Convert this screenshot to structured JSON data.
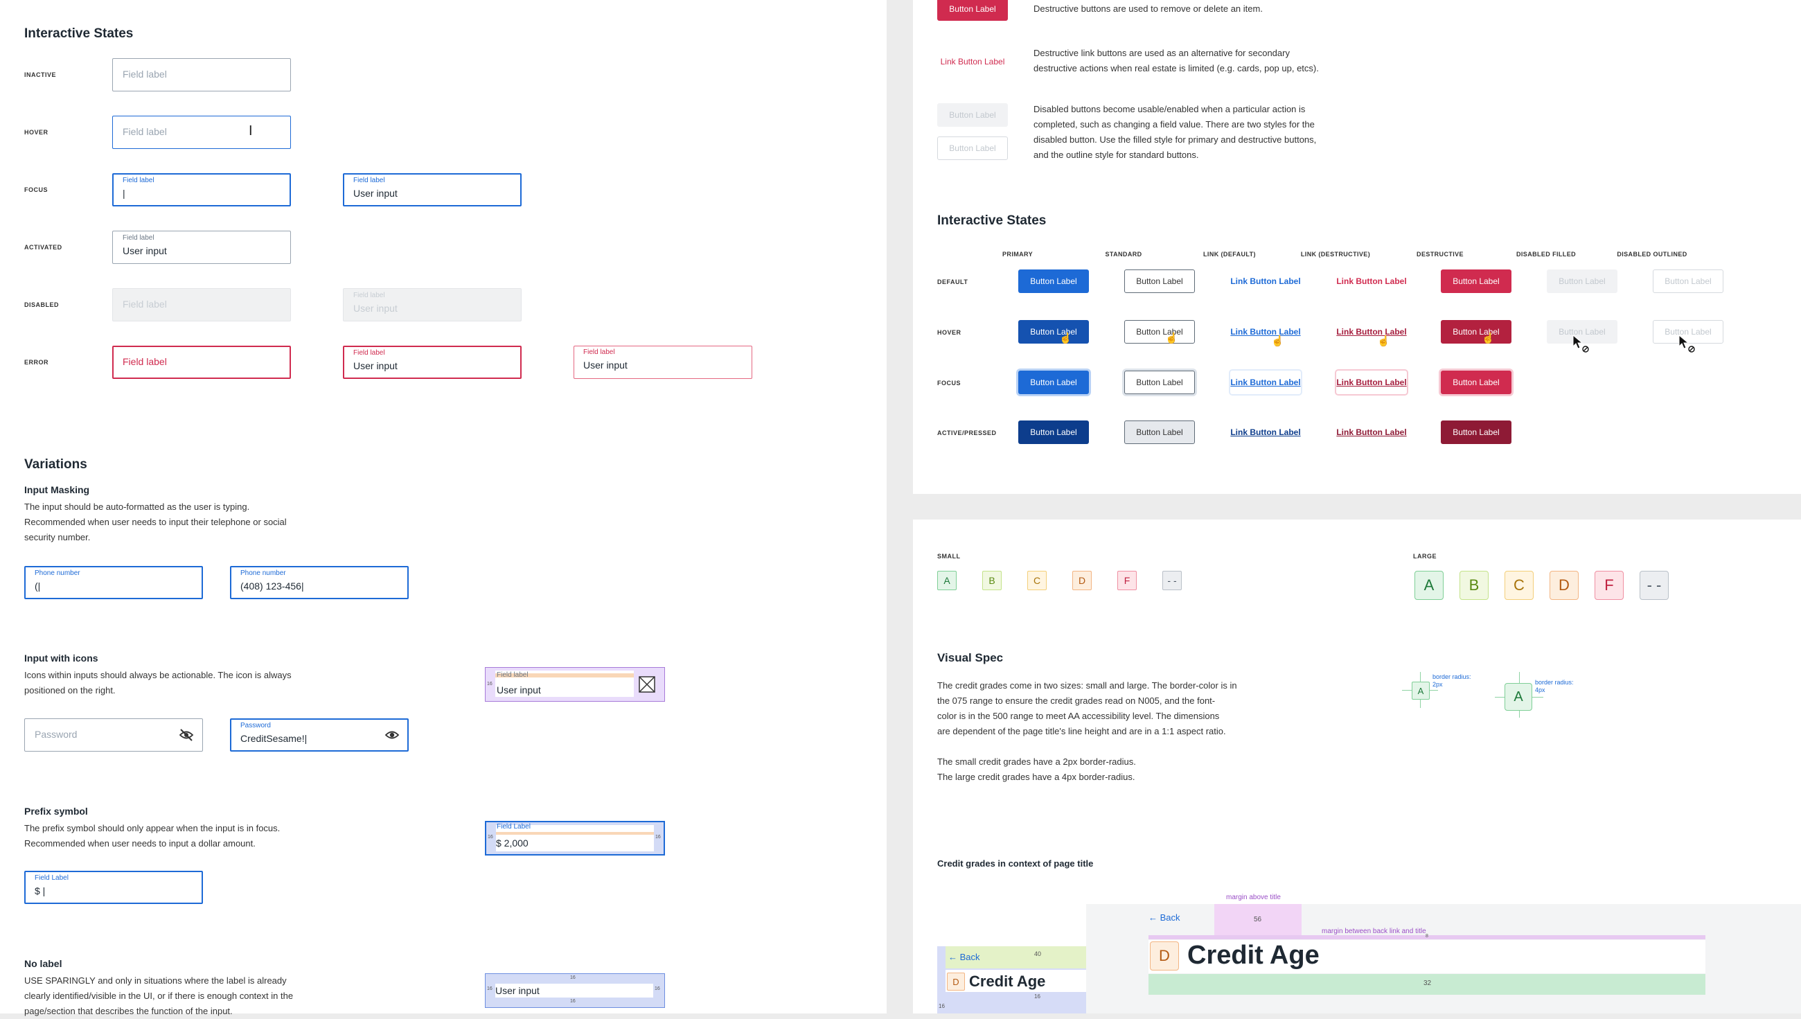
{
  "left": {
    "interactive_states": {
      "title": "Interactive States",
      "rows": {
        "inactive": "INACTIVE",
        "hover": "HOVER",
        "focus": "FOCUS",
        "activated": "ACTIVATED",
        "disabled": "DISABLED",
        "error": "ERROR"
      },
      "field_label": "Field label",
      "user_input": "User input",
      "focus_caret": "|"
    },
    "variations": {
      "title": "Variations",
      "masking": {
        "title": "Input Masking",
        "desc1": "The input should be auto-formatted as the user is typing.",
        "desc2": "Recommended when user needs to input their telephone or social",
        "desc3": "security number.",
        "label": "Phone number",
        "value1": "(|",
        "value2": "(408) 123-456|"
      },
      "icons": {
        "title": "Input with icons",
        "desc1": "Icons within inputs should always be actionable. The icon is always",
        "desc2": "positioned on the right.",
        "password_placeholder": "Password",
        "password_label": "Password",
        "password_value": "CreditSesame!|",
        "spec_label": "Field label",
        "spec_value": "User input",
        "spec_num": "16"
      },
      "prefix": {
        "title": "Prefix symbol",
        "desc1": "The prefix symbol should only appear when the input is in focus.",
        "desc2": "Recommended when user needs to input a dollar amount.",
        "label": "Field Label",
        "value": "$  |",
        "spec_value": "$ 2,000",
        "spec_num": "16"
      },
      "nolabel": {
        "title": "No label",
        "desc1": "USE SPARINGLY and only in situations where the label is already",
        "desc2": "clearly identified/visible in the UI, or if there is enough context in the",
        "desc3": "page/section that describes the function of the input.",
        "spec_value": "User input",
        "spec_num": "16"
      }
    }
  },
  "right_top": {
    "destructive_button": "Button Label",
    "destructive_desc": "Destructive buttons are used to remove or delete an item.",
    "link_button": "Link Button Label",
    "link_desc1": "Destructive link buttons are used as an alternative for secondary",
    "link_desc2": "destructive actions when real estate is limited (e.g. cards, pop up, etcs).",
    "disabled_button": "Button Label",
    "disabled_desc1": "Disabled buttons become usable/enabled when a particular action is",
    "disabled_desc2": "completed, such as changing a field value. There are two styles for the",
    "disabled_desc3": "disabled button. Use the filled style for primary and destructive buttons,",
    "disabled_desc4": "and the outline style for standard buttons.",
    "states_title": "Interactive States",
    "columns": [
      "PRIMARY",
      "STANDARD",
      "LINK (DEFAULT)",
      "LINK (DESTRUCTIVE)",
      "DESTRUCTIVE",
      "DISABLED FILLED",
      "DISABLED OUTLINED"
    ],
    "rows": [
      "DEFAULT",
      "HOVER",
      "FOCUS",
      "ACTIVE/PRESSED"
    ],
    "button_label": "Button Label",
    "link_label": "Link Button Label"
  },
  "right_bottom": {
    "small": "SMALL",
    "large": "LARGE",
    "grades": [
      "A",
      "B",
      "C",
      "D",
      "F",
      "- -"
    ],
    "visual_spec_title": "Visual Spec",
    "spec1": "The credit grades come in two sizes: small and large. The border-color is in",
    "spec2": "the 075 range to ensure the credit grades read on N005, and the font-",
    "spec3": "color is in the 500 range to meet AA accessibility level. The dimensions",
    "spec4": "are dependent of the page title's line height and are in a 1:1 aspect ratio.",
    "spec5": "The small credit grades have a 2px border-radius.",
    "spec6": "The large credit grades have a 4px border-radius.",
    "radius_small": "border radius: 2px",
    "radius_large": "border radius: 4px",
    "context_title": "Credit grades in context of page title",
    "back": "Back",
    "credit_age": "Credit Age",
    "grade_d": "D",
    "margin_above": "margin above title",
    "margin_between": "margin between back link and title",
    "n56": "56",
    "n40": "40",
    "n32": "32",
    "n16": "16",
    "n8": "8"
  }
}
